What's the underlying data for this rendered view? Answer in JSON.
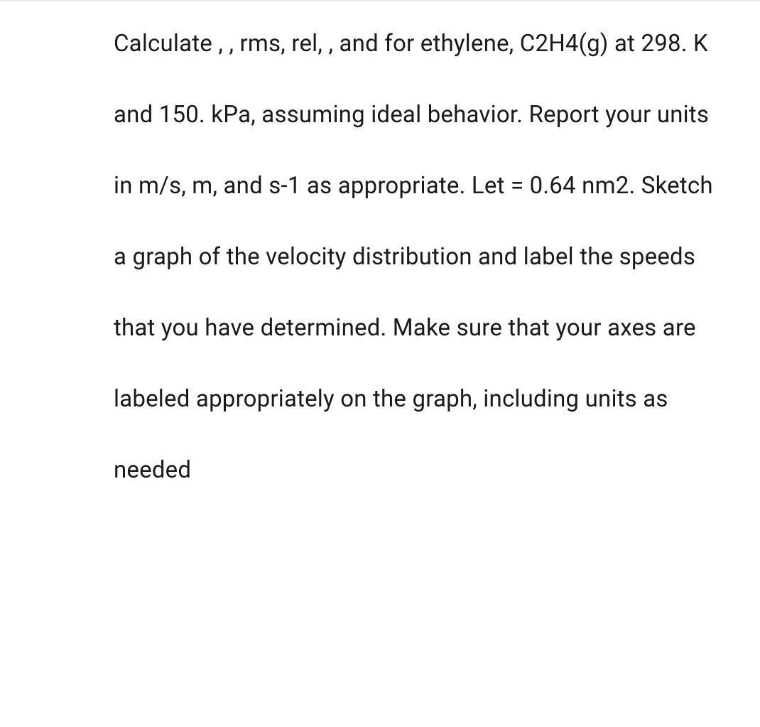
{
  "question": {
    "text": "Calculate , , rms, rel, , and for ethylene, C2H4(g) at 298. K and 150. kPa, assuming ideal behavior. Report your units in m/s, m, and s-1 as appropriate. Let = 0.64 nm2. Sketch a graph of the velocity distribution and label the speeds that you have determined. Make sure that your axes are labeled appropriately on the graph, including units as needed"
  }
}
